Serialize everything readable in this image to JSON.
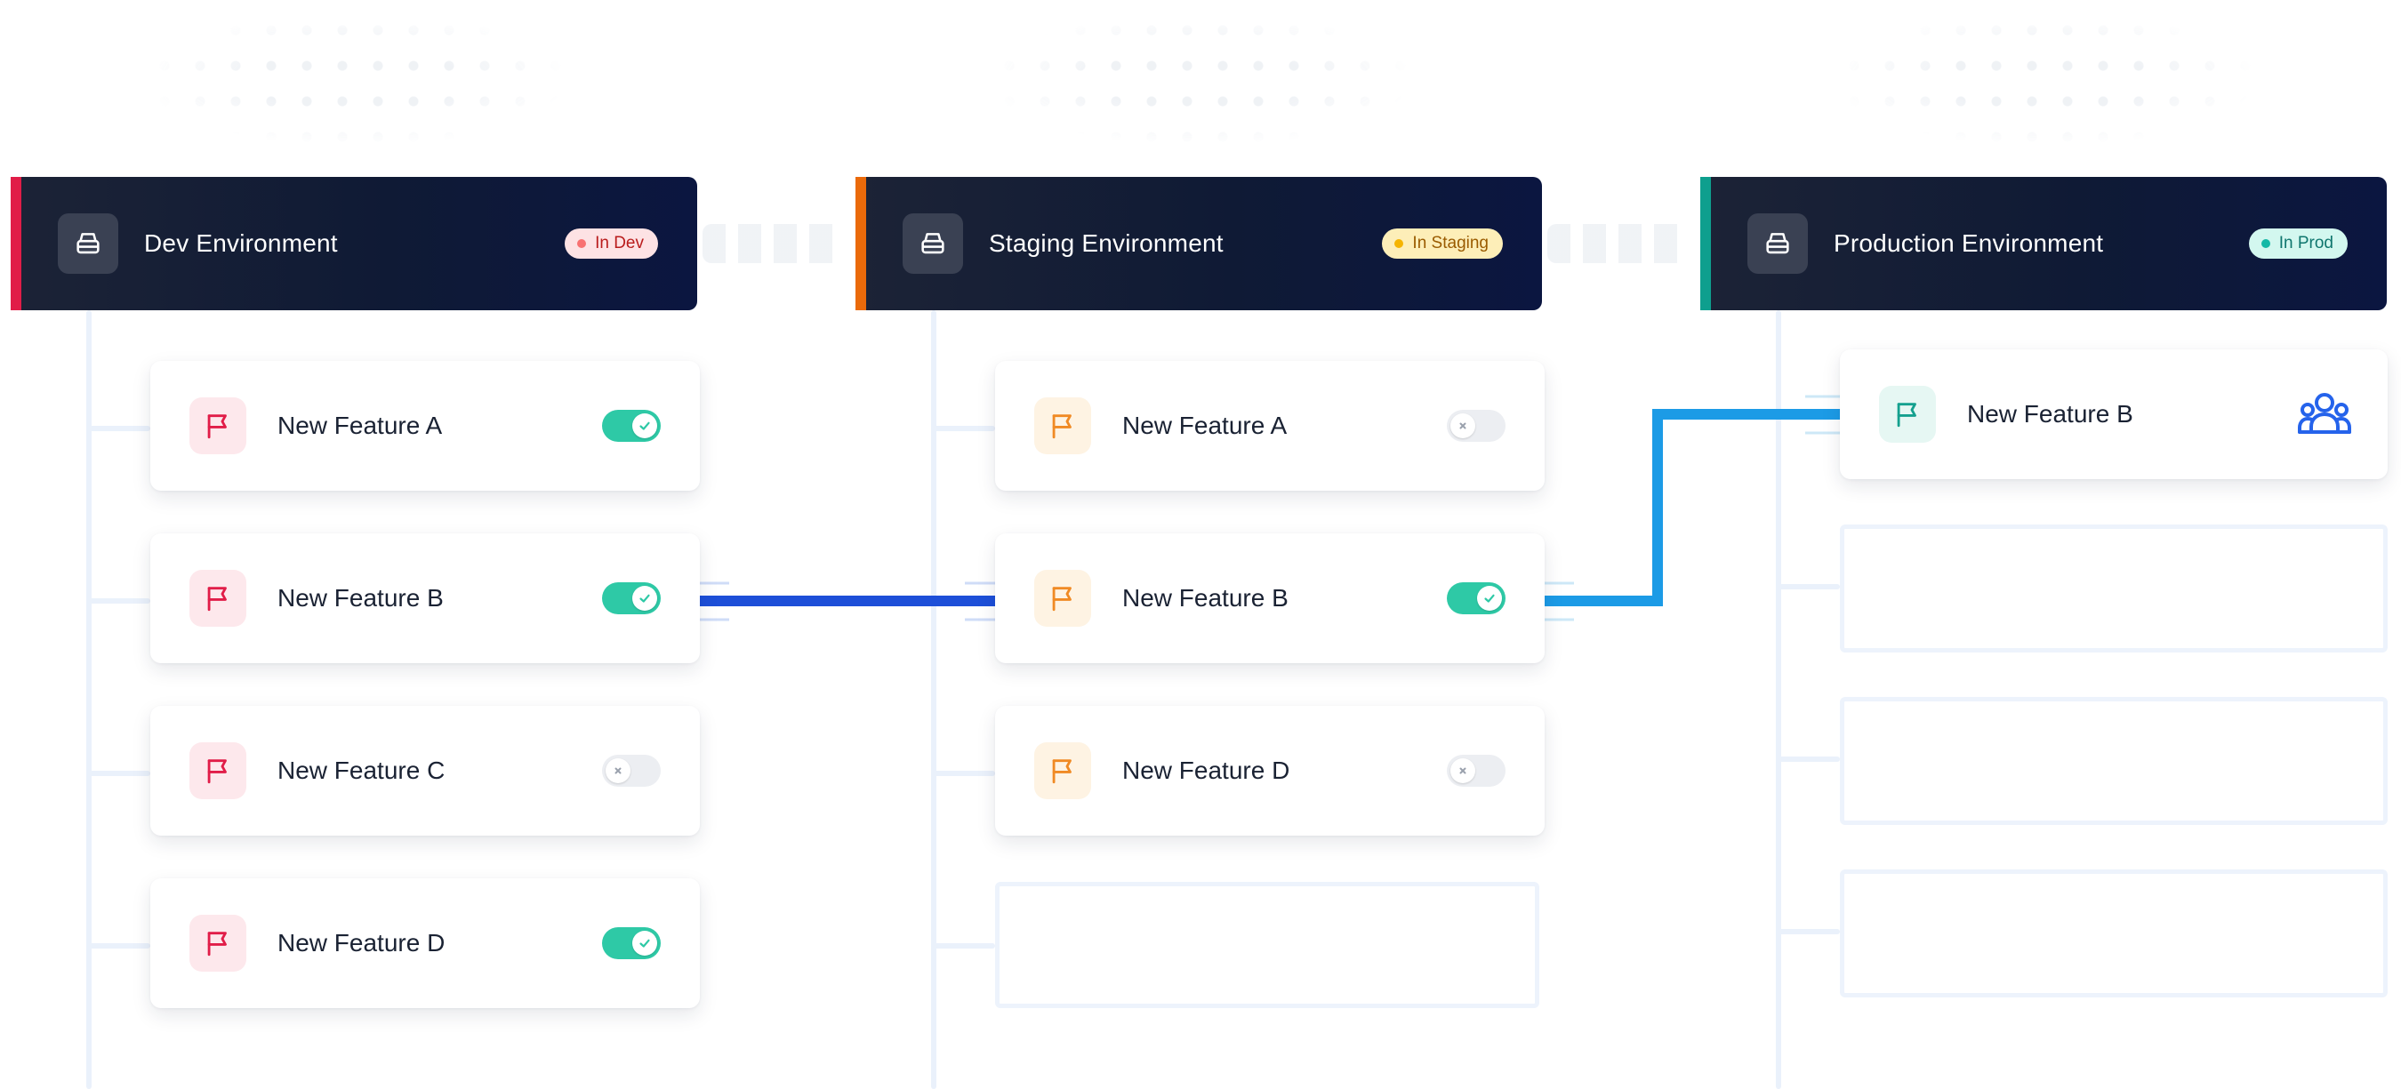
{
  "environments": [
    {
      "title": "Dev Environment",
      "badge": "In Dev",
      "accent": "#e11d48",
      "badge_bg": "#fde2e4",
      "badge_dot": "#f87171",
      "badge_text": "#b91c1c",
      "icon": "server-icon",
      "features": [
        {
          "label": "New Feature A",
          "enabled": true
        },
        {
          "label": "New Feature B",
          "enabled": true
        },
        {
          "label": "New Feature C",
          "enabled": false
        },
        {
          "label": "New Feature D",
          "enabled": true
        }
      ]
    },
    {
      "title": "Staging Environment",
      "badge": "In Staging",
      "accent": "#ea6a0a",
      "badge_bg": "#fdeeb8",
      "badge_dot": "#f5b400",
      "badge_text": "#9a5b00",
      "icon": "server-icon",
      "features": [
        {
          "label": "New Feature A",
          "enabled": false
        },
        {
          "label": "New Feature B",
          "enabled": true
        },
        {
          "label": "New Feature D",
          "enabled": false
        }
      ]
    },
    {
      "title": "Production Environment",
      "badge": "In Prod",
      "accent": "#0e9f8e",
      "badge_bg": "#d3f7ef",
      "badge_dot": "#14b8a6",
      "badge_text": "#0f766e",
      "icon": "server-icon",
      "features": [
        {
          "label": "New Feature B",
          "target": "users-icon"
        }
      ]
    }
  ],
  "colors": {
    "toggle_on": "#2ec9a6",
    "toggle_off": "#eceef2",
    "connector_dev_staging": "#1d4fd8",
    "connector_staging_prod": "#1c9be6",
    "users_icon": "#2563eb",
    "flag_dev": "#e11d48",
    "flag_staging": "#f08a24",
    "flag_prod": "#14a08e"
  }
}
